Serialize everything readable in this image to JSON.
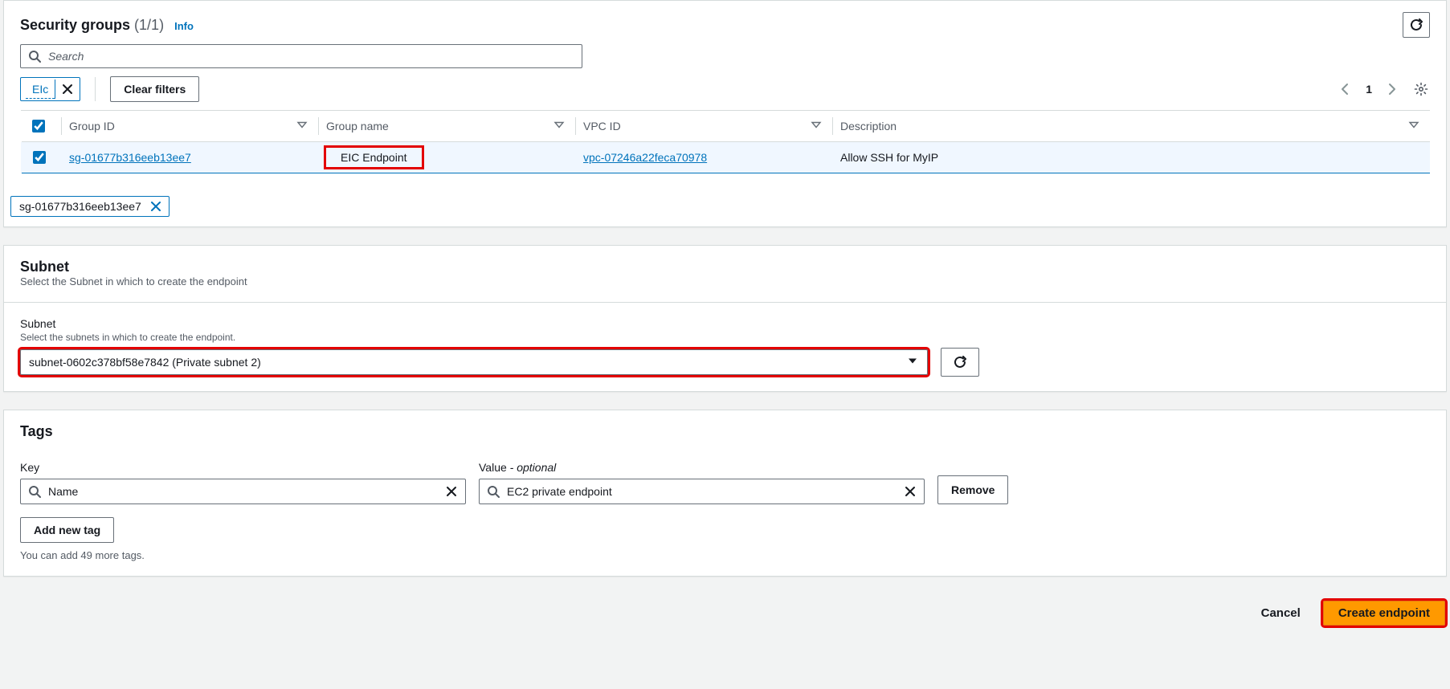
{
  "securityGroups": {
    "title": "Security groups",
    "count": "(1/1)",
    "infoLabel": "Info",
    "searchPlaceholder": "Search",
    "filterChip": "EIc",
    "clearFilters": "Clear filters",
    "pageNumber": "1",
    "columns": {
      "groupId": "Group ID",
      "groupName": "Group name",
      "vpcId": "VPC ID",
      "description": "Description"
    },
    "row": {
      "groupId": "sg-01677b316eeb13ee7",
      "groupName": "EIC Endpoint",
      "vpcId": "vpc-07246a22feca70978",
      "description": "Allow SSH for MyIP"
    },
    "selectedToken": "sg-01677b316eeb13ee7"
  },
  "subnet": {
    "heading": "Subnet",
    "headingHint": "Select the Subnet in which to create the endpoint",
    "fieldLabel": "Subnet",
    "fieldHint": "Select the subnets in which to create the endpoint.",
    "selected": "subnet-0602c378bf58e7842 (Private subnet 2)"
  },
  "tags": {
    "heading": "Tags",
    "keyLabel": "Key",
    "valueLabelPrefix": "Value",
    "valueLabelSuffix": " - optional",
    "keyValue": "Name",
    "valueValue": "EC2 private endpoint",
    "removeLabel": "Remove",
    "addLabel": "Add new tag",
    "limitText": "You can add 49 more tags."
  },
  "footer": {
    "cancel": "Cancel",
    "create": "Create endpoint"
  }
}
